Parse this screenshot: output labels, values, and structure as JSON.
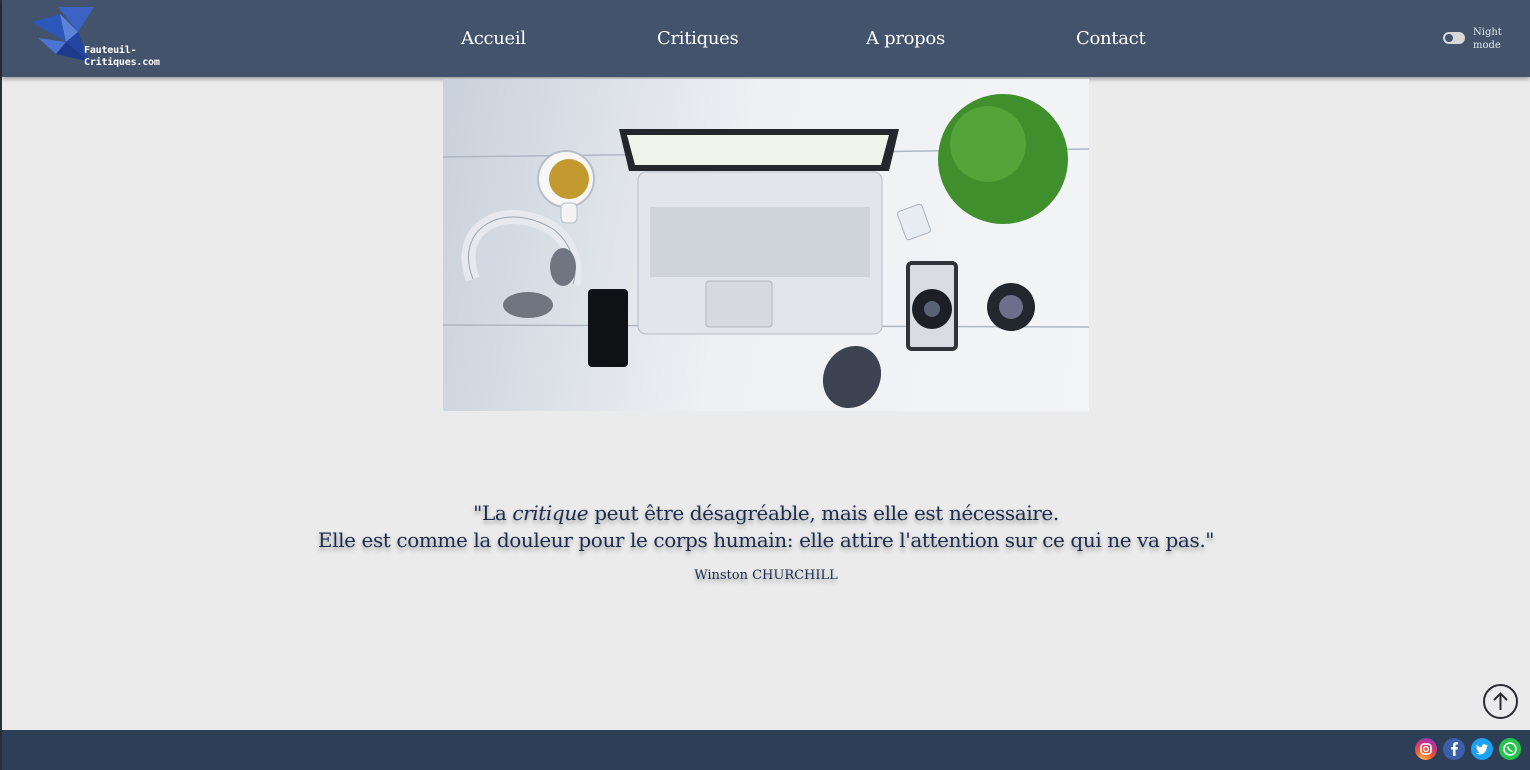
{
  "header": {
    "logo_line1": "Fauteuil-",
    "logo_line2": "Critiques.com",
    "nav": [
      "Accueil",
      "Critiques",
      "A propos",
      "Contact"
    ],
    "night_mode_label": "Night mode"
  },
  "hero_image": {
    "icon": "desk-flatlay-photo"
  },
  "quote": {
    "line1_before": "\"La ",
    "line1_em": "critique",
    "line1_after": " peut être désagréable, mais elle est nécessaire.",
    "line2": "Elle est comme la douleur pour le corps humain: elle attire l'attention sur ce qui ne va pas.\"",
    "author": "Winston CHURCHILL"
  },
  "footer": {
    "socials": [
      "instagram-icon",
      "facebook-icon",
      "twitter-icon",
      "whatsapp-icon"
    ]
  },
  "colors": {
    "header_bg": "#43536b",
    "footer_bg": "#2d3e57",
    "page_bg": "#ebebeb",
    "quote_text": "#1c2c4e"
  }
}
